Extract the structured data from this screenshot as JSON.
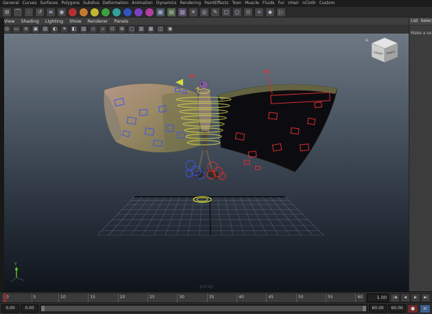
{
  "shelf": {
    "tabs": [
      "General",
      "Curves",
      "Surfaces",
      "Polygons",
      "Subdivs",
      "Deformation",
      "Animation",
      "Dynamics",
      "Rendering",
      "PaintEffects",
      "Toon",
      "Muscle",
      "Fluids",
      "Fur",
      "nHair",
      "nCloth",
      "Custom"
    ],
    "icons": [
      {
        "name": "snap-grid-icon",
        "glyph": "⊞"
      },
      {
        "name": "snap-curve-icon",
        "glyph": "⌒"
      },
      {
        "name": "snap-point-icon",
        "glyph": "∴"
      },
      {
        "name": "construction-history-icon",
        "glyph": "↺"
      },
      {
        "name": "list-input-icon",
        "glyph": "≡"
      },
      {
        "name": "render-view-icon",
        "glyph": "◉"
      },
      {
        "name": "material-ball-red-icon",
        "shape": "circle",
        "color": "#b23232"
      },
      {
        "name": "material-ball-orange-icon",
        "shape": "circle",
        "color": "#c27a32"
      },
      {
        "name": "material-ball-yellow-icon",
        "shape": "circle",
        "color": "#c2b632"
      },
      {
        "name": "material-ball-green-icon",
        "shape": "circle",
        "color": "#3f9f3f"
      },
      {
        "name": "material-ball-teal-icon",
        "shape": "circle",
        "color": "#32a0a0"
      },
      {
        "name": "material-ball-blue-icon",
        "shape": "circle",
        "color": "#3253c2"
      },
      {
        "name": "material-ball-purple-icon",
        "shape": "circle",
        "color": "#7d3fc2"
      },
      {
        "name": "material-ball-pink-icon",
        "shape": "circle",
        "color": "#b23f9f"
      },
      {
        "name": "checker-texture-icon",
        "glyph": "▦",
        "color": "#4a5668"
      },
      {
        "name": "ramp-texture-icon",
        "glyph": "▤",
        "color": "#566848"
      },
      {
        "name": "noise-texture-icon",
        "glyph": "▨",
        "color": "#5a4a68"
      },
      {
        "name": "light-icon",
        "glyph": "☀"
      },
      {
        "name": "camera-icon",
        "glyph": "◎"
      },
      {
        "name": "paint-effects-icon",
        "glyph": "✎"
      },
      {
        "name": "poly-cube-icon",
        "glyph": "◻"
      },
      {
        "name": "poly-sphere-icon",
        "glyph": "○"
      },
      {
        "name": "nurbs-circle-icon",
        "glyph": "⊙"
      },
      {
        "name": "joint-tool-icon",
        "glyph": "+"
      },
      {
        "name": "constraint-icon",
        "glyph": "◆"
      },
      {
        "name": "playblast-icon",
        "glyph": "▷"
      }
    ]
  },
  "panel": {
    "menu": [
      "View",
      "Shading",
      "Lighting",
      "Show",
      "Renderer",
      "Panels"
    ],
    "toolbar_icons": [
      {
        "name": "select-camera-icon",
        "glyph": "◎"
      },
      {
        "name": "lock-camera-icon",
        "glyph": "▭"
      },
      {
        "name": "camera-attributes-icon",
        "glyph": "≡"
      },
      {
        "name": "bookmarks-icon",
        "glyph": "▣"
      },
      {
        "name": "image-plane-icon",
        "glyph": "▤"
      },
      {
        "name": "two-sided-lighting-icon",
        "glyph": "◐"
      },
      {
        "name": "default-lighting-icon",
        "glyph": "☀"
      },
      {
        "name": "shaded-mode-icon",
        "glyph": "◧"
      },
      {
        "name": "textured-mode-icon",
        "glyph": "▨"
      },
      {
        "name": "wireframe-on-shaded-icon",
        "glyph": "◇"
      },
      {
        "name": "xray-icon",
        "glyph": "▫"
      },
      {
        "name": "isolate-select-icon",
        "glyph": "⊡"
      },
      {
        "name": "grid-toggle-icon",
        "glyph": "⊞"
      },
      {
        "name": "film-gate-icon",
        "glyph": "▢"
      },
      {
        "name": "resolution-gate-icon",
        "glyph": "▥"
      },
      {
        "name": "gate-mask-icon",
        "glyph": "▦"
      },
      {
        "name": "field-chart-icon",
        "glyph": "◫"
      },
      {
        "name": "safe-action-icon",
        "glyph": "◉"
      }
    ]
  },
  "viewport": {
    "ik_left": "IK",
    "ik_right": "IK",
    "camera": "persp",
    "axis_y_label": "Y",
    "viewcube": {
      "front": "FRONT",
      "right": "RIGHT",
      "home_icon": "⌂"
    }
  },
  "right_panel": {
    "menu_items": [
      "List",
      "Selected"
    ],
    "message": "Make a se..."
  },
  "timeline": {
    "ticks": [
      "0",
      "5",
      "10",
      "15",
      "20",
      "25",
      "30",
      "35",
      "40",
      "45",
      "50",
      "55",
      "60"
    ],
    "current_time": "1.00",
    "transport": [
      {
        "name": "go-to-start-button",
        "glyph": "|◀"
      },
      {
        "name": "step-back-button",
        "glyph": "◀"
      },
      {
        "name": "play-button",
        "glyph": "▶"
      },
      {
        "name": "go-to-end-button",
        "glyph": "▶|"
      }
    ]
  },
  "range": {
    "anim_start": "0.00",
    "play_start": "0.00",
    "play_end": "60.00",
    "anim_end": "60.00",
    "buttons": [
      {
        "name": "auto-key-button",
        "glyph": "●",
        "color": "#6e2a2a"
      },
      {
        "name": "anim-prefs-button",
        "glyph": "≡",
        "color": "#3d5f8f"
      }
    ]
  },
  "colors": {
    "ik_red": "#e23030",
    "control_blue": "#3d55e6",
    "control_red": "#dc2f2f",
    "control_yellow": "#d9d94d",
    "viewport_top": "#6d7884",
    "viewport_bottom": "#10151c"
  }
}
